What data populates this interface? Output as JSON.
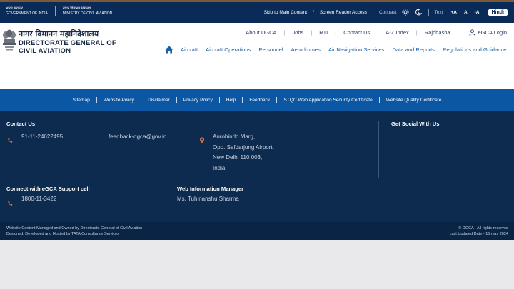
{
  "govbar": {
    "gov_hi": "भारत सरकार",
    "gov_en": "GOVERNMENT OF INDIA",
    "min_hi": "नागर विमानन मंत्रालय",
    "min_en": "MINISTRY OF CIVIL AVIATION",
    "skip": "Skip to Main Content",
    "slash": "/",
    "reader": "Screen Reader Access",
    "contrast": "Contrast",
    "text": "Text",
    "font_increase": "+A",
    "font_normal": "A",
    "font_decrease": "-A",
    "hindi": "Hindi",
    "icons": [
      "sun-icon",
      "moon-icon"
    ]
  },
  "header": {
    "org_hi": "नागर विमानन महानिदेशालय",
    "org_en_line1": "DIRECTORATE GENERAL OF",
    "org_en_line2": "CIVIL AVIATION",
    "top_links": [
      "About DGCA",
      "Jobs",
      "RTI",
      "Contact Us",
      "A-Z Index",
      "Rajbhasha"
    ],
    "login": "eGCA Login",
    "nav": [
      "Aircraft",
      "Aircraft Operations",
      "Personnel",
      "Aerodromes",
      "Air Navigation Services",
      "Data and Reports",
      "Regulations and Guidance"
    ]
  },
  "linkbar": [
    "Sitemap",
    "Website Policy",
    "Disclaimer",
    "Privacy Policy",
    "Help",
    "Feedback",
    "STQC Web Application Security Certificate",
    "Website Quality Certificate"
  ],
  "footer": {
    "contact_title": "Contact Us",
    "phone": "91-11-24622495",
    "email": "feedback-dgca@gov.in",
    "address": [
      "Aurobindo Marg,",
      "Opp. Safdarjung Airport,",
      "New Delhi 110 003,",
      "India"
    ],
    "social_title": "Get Social With Us",
    "support_title": "Connect with eGCA Support cell",
    "support_phone": "1800-11-3422",
    "wim_title": "Web Information Manager",
    "wim_name": "Ms. Tuhinanshu Sharma"
  },
  "bottombar": {
    "left1": "Website Content Managed and Owned by Directorate General of Civil Aviation",
    "left2": "Designed, Developed and Hosted by TATA Consultancy Services",
    "right1": "© DGCA - All rights reserved",
    "right2": "Last Updated Date - 15 may 2024"
  },
  "colors": {
    "govbar": "#0a2a57",
    "nav_link": "#1a5fa8",
    "linkbar": "#0b57a4",
    "footer": "#0d2b4f",
    "accent_icon": "#d9774a"
  }
}
